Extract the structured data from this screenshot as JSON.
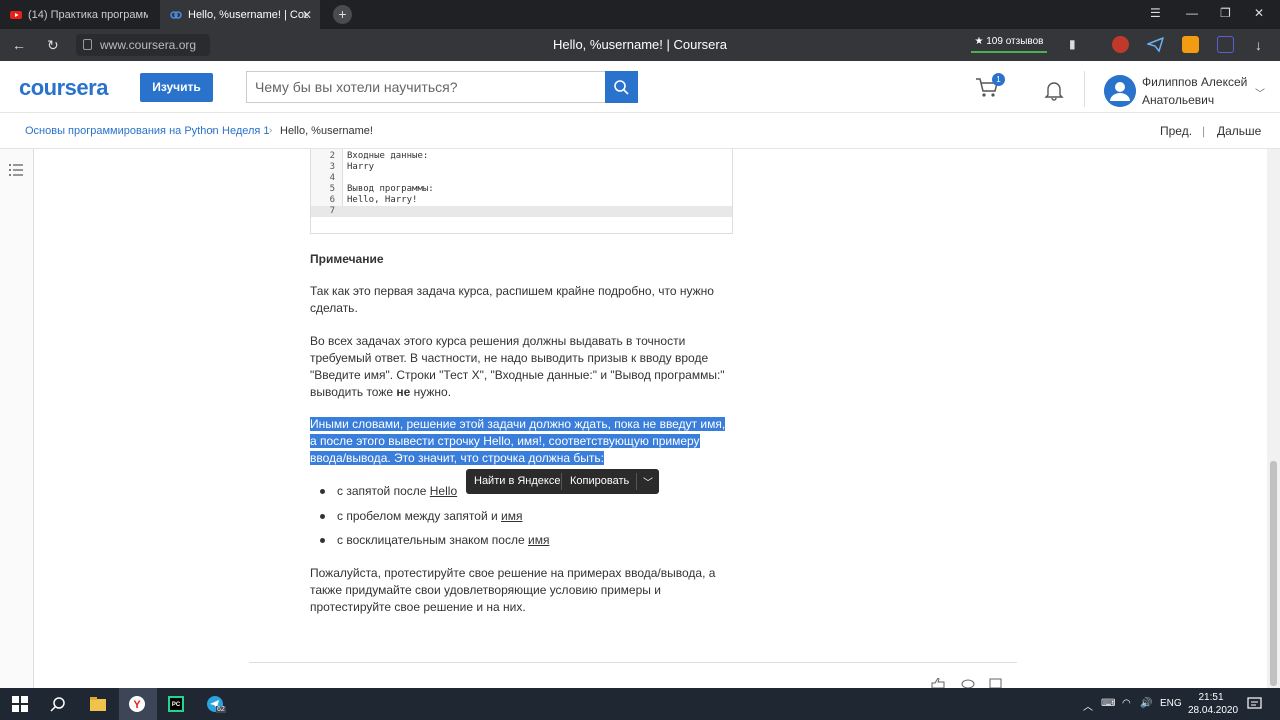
{
  "browser": {
    "tabs": [
      {
        "title": "(14) Практика программи"
      },
      {
        "title": "Hello, %username! | Cou"
      }
    ],
    "new_tab": "+",
    "url": "www.coursera.org",
    "page_title": "Hello, %username! | Coursera",
    "rating": "★ 109 отзывов"
  },
  "header": {
    "logo": "coursera",
    "learn_button": "Изучить",
    "search_placeholder": "Чему бы вы хотели научиться?",
    "cart_count": "1",
    "user_name_line1": "Филиппов Алексей",
    "user_name_line2": "Анатольевич"
  },
  "breadcrumbs": {
    "items": [
      "Основы программирования на Python",
      "Неделя 1",
      "Hello, %username!"
    ],
    "prev": "Пред.",
    "next": "Дальше",
    "sep": "|"
  },
  "code": {
    "lines": [
      {
        "n": "2",
        "text": "Входные данные:"
      },
      {
        "n": "3",
        "text": "Harry"
      },
      {
        "n": "4",
        "text": ""
      },
      {
        "n": "5",
        "text": "Вывод программы:"
      },
      {
        "n": "6",
        "text": "Hello, Harry!"
      },
      {
        "n": "7",
        "text": ""
      }
    ]
  },
  "article": {
    "note_heading": "Примечание",
    "p1": "Так как это первая задача курса, распишем крайне подробно, что нужно сделать.",
    "p2_a": "Во всех задачах этого курса решения должны выдавать в точности требуемый ответ. В частности, не надо выводить призыв к вводу вроде \"Введите имя\". Строки \"Тест X\", \"Входные данные:\" и \"Вывод программы:\" выводить тоже ",
    "p2_bold": "не",
    "p2_b": " нужно.",
    "p3_highlighted": "Иными словами, решение этой задачи должно ждать, пока не введут имя, а после этого вывести строчку Hello, имя!, соответствующую примеру ввода/вывода. Это значит, что строчка должна быть:",
    "bullets": [
      {
        "prefix": "с запятой после ",
        "u": "Hello"
      },
      {
        "prefix": "с пробелом между запятой и ",
        "u": "имя"
      },
      {
        "prefix": "с восклицательным знаком после ",
        "u": "имя"
      }
    ],
    "p4": "Пожалуйста, протестируйте свое решение на примерах ввода/вывода, а также придумайте свои удовлетворяющие условию примеры и протестируйте свое решение и на них."
  },
  "popup": {
    "find": "Найти в Яндексе",
    "copy": "Копировать",
    "more": "﹀"
  },
  "taskbar": {
    "lang": "ENG",
    "time": "21:51",
    "date": "28.04.2020",
    "badge": "62"
  },
  "colors": {
    "accent": "#2a73cc",
    "selection": "#3a7edb",
    "taskbar": "#1f2733"
  }
}
